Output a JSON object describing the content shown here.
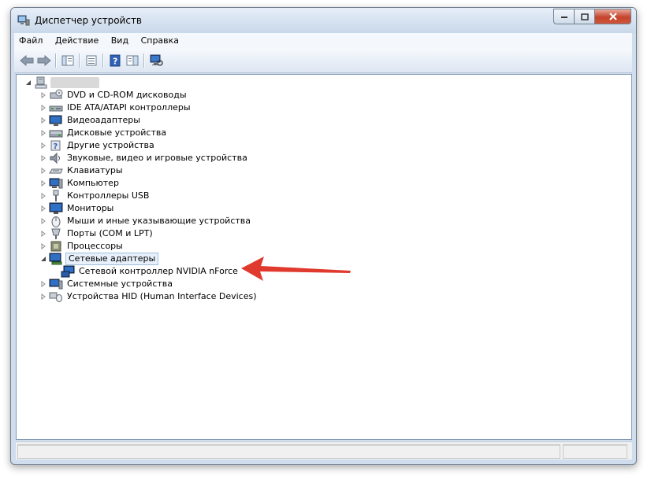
{
  "window": {
    "title": "Диспетчер устройств"
  },
  "menu": [
    "Файл",
    "Действие",
    "Вид",
    "Справка"
  ],
  "tree": {
    "root_label": "",
    "categories": [
      {
        "label": "DVD и CD-ROM дисководы",
        "icon": "dvd-drive-icon"
      },
      {
        "label": "IDE ATA/ATAPI контроллеры",
        "icon": "ide-controller-icon"
      },
      {
        "label": "Видеоадаптеры",
        "icon": "display-adapter-icon"
      },
      {
        "label": "Дисковые устройства",
        "icon": "disk-drive-icon"
      },
      {
        "label": "Другие устройства",
        "icon": "unknown-device-icon"
      },
      {
        "label": "Звуковые, видео и игровые устройства",
        "icon": "sound-icon"
      },
      {
        "label": "Клавиатуры",
        "icon": "keyboard-icon"
      },
      {
        "label": "Компьютер",
        "icon": "computer-icon"
      },
      {
        "label": "Контроллеры USB",
        "icon": "usb-icon"
      },
      {
        "label": "Мониторы",
        "icon": "monitor-icon"
      },
      {
        "label": "Мыши и иные указывающие устройства",
        "icon": "mouse-icon"
      },
      {
        "label": "Порты (COM и LPT)",
        "icon": "port-icon"
      },
      {
        "label": "Процессоры",
        "icon": "processor-icon"
      },
      {
        "label": "Сетевые адаптеры",
        "icon": "network-adapter-icon",
        "expanded": true,
        "selected": true
      },
      {
        "label": "Сетевой контроллер NVIDIA nForce",
        "icon": "network-card-icon",
        "child": true
      },
      {
        "label": "Системные устройства",
        "icon": "system-device-icon"
      },
      {
        "label": "Устройства HID (Human Interface Devices)",
        "icon": "hid-icon"
      }
    ]
  },
  "annotation": {
    "arrow_color": "#e03a2f"
  }
}
